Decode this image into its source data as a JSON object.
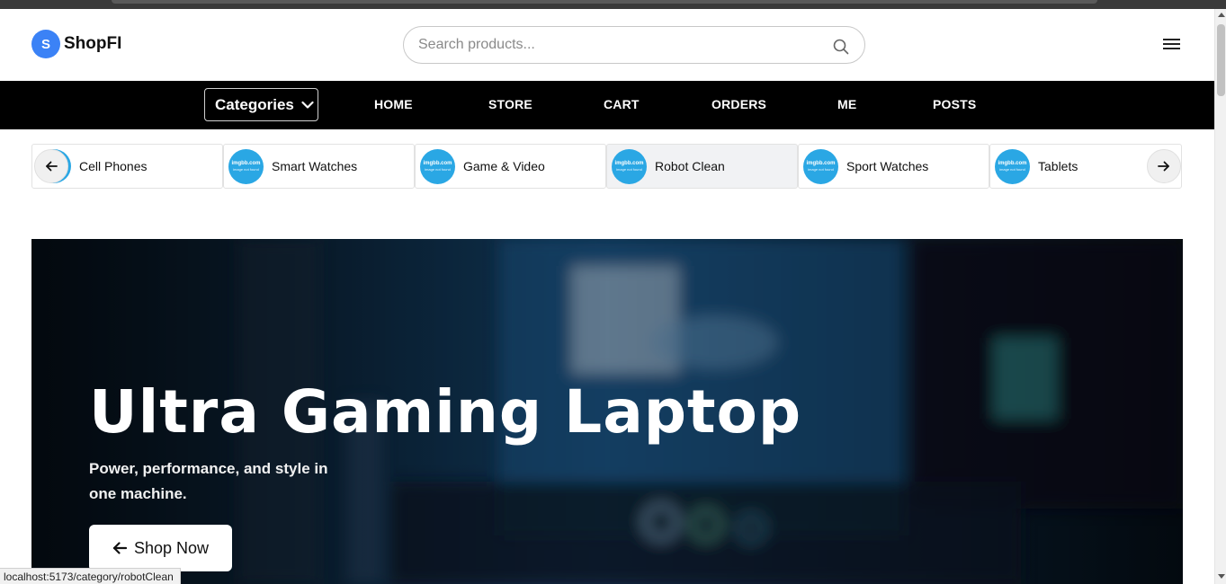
{
  "header": {
    "logo_letter": "S",
    "logo_text": "ShopFI",
    "search_placeholder": "Search products..."
  },
  "navbar": {
    "categories_label": "Categories",
    "links": [
      "HOME",
      "STORE",
      "CART",
      "ORDERS",
      "ME",
      "POSTS"
    ]
  },
  "category_strip": {
    "items": [
      {
        "label": "Cell Phones"
      },
      {
        "label": "Smart Watches"
      },
      {
        "label": "Game & Video"
      },
      {
        "label": "Robot Clean",
        "active": true
      },
      {
        "label": "Sport Watches"
      },
      {
        "label": "Tablets"
      }
    ],
    "placeholder_image_text": "imgbb.com",
    "placeholder_image_subtext": "image not found"
  },
  "hero": {
    "title": "Ultra Gaming Laptop",
    "subtitle": "Power, performance, and style in one machine.",
    "button_label": "Shop Now"
  },
  "status_bar": {
    "url": "localhost:5173/category/robotClean"
  },
  "colors": {
    "brand": "#3b82f6",
    "navbar_bg": "#000000",
    "thumb_bg": "#2aa7e4"
  }
}
